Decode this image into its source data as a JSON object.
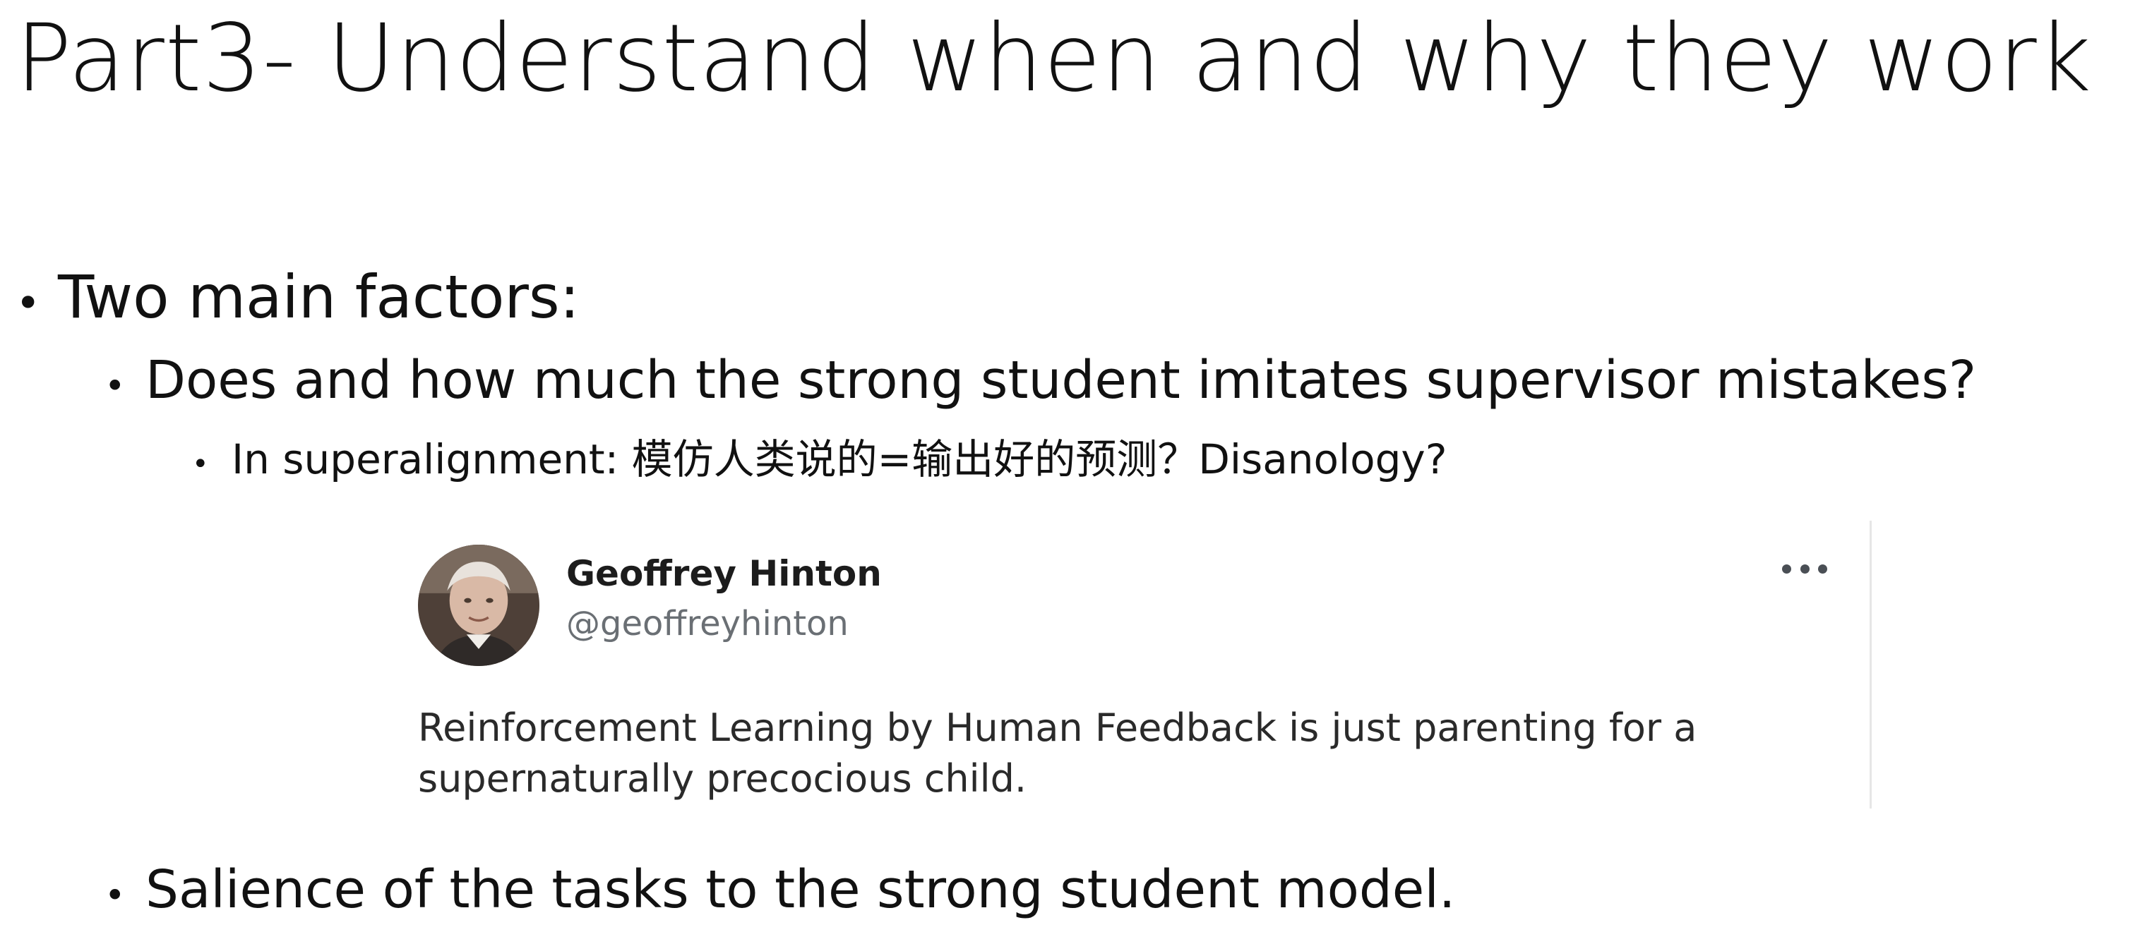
{
  "slide": {
    "title": "Part3- Understand when and why they work"
  },
  "bullets": {
    "glyph": "•",
    "level1": "Two main factors:",
    "level2_first": "Does and how much the strong student imitates supervisor mistakes?",
    "level3": "In superalignment: 模仿人类说的=输出好的预测？Disanology?",
    "level2_second": "Salience of the tasks to the strong student model."
  },
  "tweet": {
    "author_name": "Geoffrey Hinton",
    "author_handle": "@geoffreyhinton",
    "text": "Reinforcement Learning by Human Feedback is just parenting for a supernaturally precocious child.",
    "avatar_icon": "person-avatar-icon",
    "more_icon": "more-options-icon"
  },
  "colors": {
    "text": "#111111",
    "tweet_text": "#2a2a2a",
    "handle": "#6a6f74",
    "card_border": "#e6e6e6"
  }
}
